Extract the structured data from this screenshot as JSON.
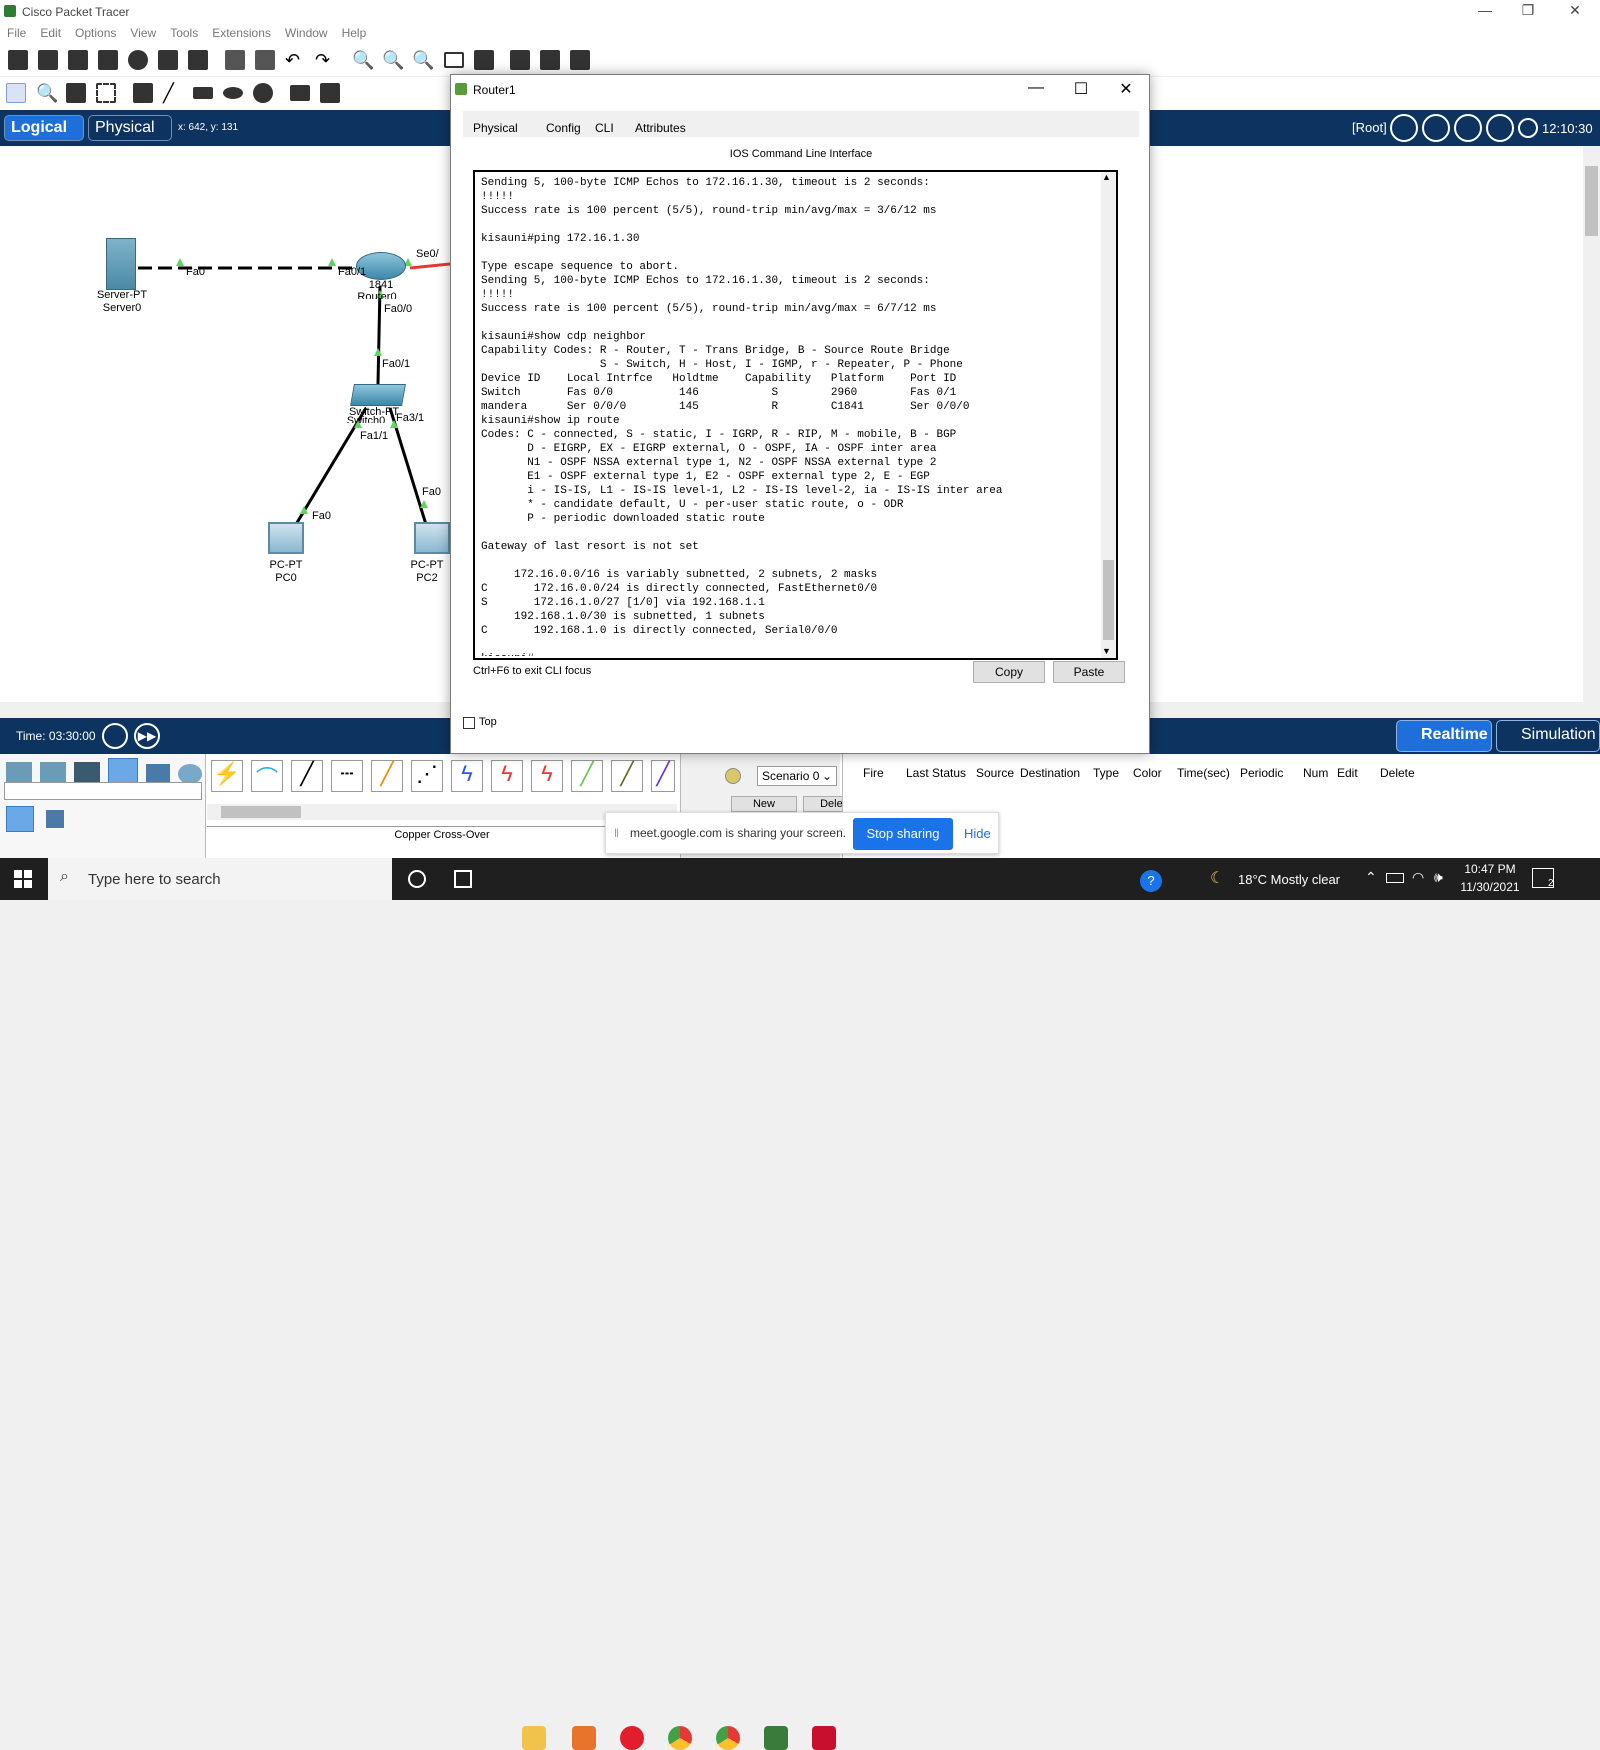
{
  "app": {
    "title": "Cisco Packet Tracer"
  },
  "menu": [
    "File",
    "Edit",
    "Options",
    "View",
    "Tools",
    "Extensions",
    "Window",
    "Help"
  ],
  "nav": {
    "logical": "Logical",
    "physical": "Physical",
    "coords": "x: 642, y: 131",
    "root": "[Root]",
    "time": "12:10:30"
  },
  "topology": {
    "server_type": "Server-PT",
    "server_name": "Server0",
    "router_model": "1841",
    "router_name": "Router0",
    "switch_type": "Switch-PT",
    "switch_name": "Switch0",
    "pc0_type": "PC-PT",
    "pc0_name": "PC0",
    "pc2_type": "PC-PT",
    "pc2_name": "PC2",
    "ports": {
      "server_fa0": "Fa0",
      "router_fa01": "Fa0/1",
      "router_se0": "Se0/",
      "router_fa00": "Fa0/0",
      "switch_fa01": "Fa0/1",
      "switch_fa31": "Fa3/1",
      "switch_fa11": "Fa1/1",
      "pc0_fa0": "Fa0",
      "pc2_fa0": "Fa0"
    }
  },
  "dialog": {
    "title": "Router1",
    "tabs": [
      "Physical",
      "Config",
      "CLI",
      "Attributes"
    ],
    "active_tab": "CLI",
    "heading": "IOS Command Line Interface",
    "cli_output": "Sending 5, 100-byte ICMP Echos to 172.16.1.30, timeout is 2 seconds:\n!!!!!\nSuccess rate is 100 percent (5/5), round-trip min/avg/max = 3/6/12 ms\n\nkisauni#ping 172.16.1.30\n\nType escape sequence to abort.\nSending 5, 100-byte ICMP Echos to 172.16.1.30, timeout is 2 seconds:\n!!!!!\nSuccess rate is 100 percent (5/5), round-trip min/avg/max = 6/7/12 ms\n\nkisauni#show cdp neighbor\nCapability Codes: R - Router, T - Trans Bridge, B - Source Route Bridge\n                  S - Switch, H - Host, I - IGMP, r - Repeater, P - Phone\nDevice ID    Local Intrfce   Holdtme    Capability   Platform    Port ID\nSwitch       Fas 0/0          146           S        2960        Fas 0/1\nmandera      Ser 0/0/0        145           R        C1841       Ser 0/0/0\nkisauni#show ip route\nCodes: C - connected, S - static, I - IGRP, R - RIP, M - mobile, B - BGP\n       D - EIGRP, EX - EIGRP external, O - OSPF, IA - OSPF inter area\n       N1 - OSPF NSSA external type 1, N2 - OSPF NSSA external type 2\n       E1 - OSPF external type 1, E2 - OSPF external type 2, E - EGP\n       i - IS-IS, L1 - IS-IS level-1, L2 - IS-IS level-2, ia - IS-IS inter area\n       * - candidate default, U - per-user static route, o - ODR\n       P - periodic downloaded static route\n\nGateway of last resort is not set\n\n     172.16.0.0/16 is variably subnetted, 2 subnets, 2 masks\nC       172.16.0.0/24 is directly connected, FastEthernet0/0\nS       172.16.1.0/27 [1/0] via 192.168.1.1\n     192.168.1.0/30 is subnetted, 1 subnets\nC       192.168.1.0 is directly connected, Serial0/0/0\n\nkisauni#",
    "hint": "Ctrl+F6 to exit CLI focus",
    "copy": "Copy",
    "paste": "Paste",
    "top_label": "Top"
  },
  "status": {
    "time": "Time: 03:30:00",
    "realtime": "Realtime",
    "simulation": "Simulation"
  },
  "bottom": {
    "scenario": "Scenario 0",
    "new": "New",
    "delete": "Delete",
    "cable_name": "Copper Cross-Over",
    "event_columns": [
      "Fire",
      "Last Status",
      "Source",
      "Destination",
      "Type",
      "Color",
      "Time(sec)",
      "Periodic",
      "Num",
      "Edit",
      "Delete"
    ]
  },
  "share": {
    "text": "meet.google.com is sharing your screen.",
    "stop": "Stop sharing",
    "hide": "Hide"
  },
  "taskbar": {
    "search": "Type here to search",
    "weather": "18°C  Mostly clear",
    "time": "10:47 PM",
    "date": "11/30/2021",
    "notif": "2"
  }
}
